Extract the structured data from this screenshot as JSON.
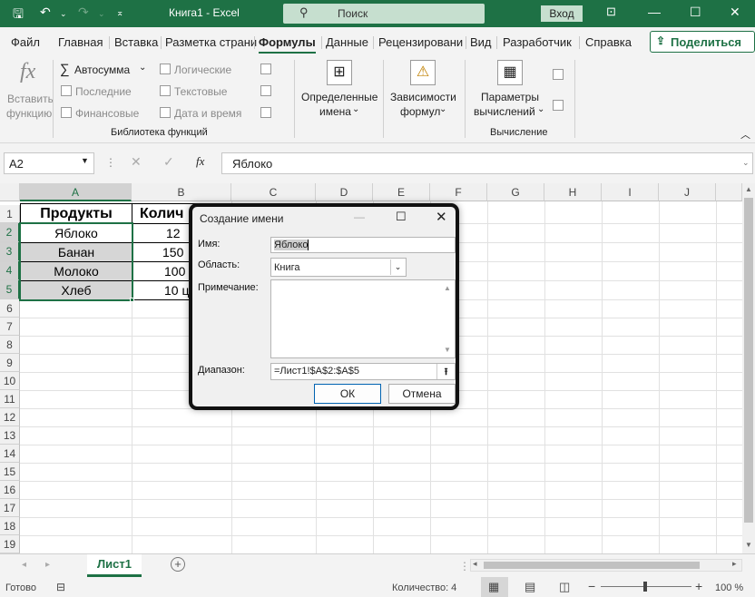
{
  "titlebar": {
    "doc_title": "Книга1  -  Excel",
    "search_placeholder": "Поиск",
    "sign_in": "Вход",
    "colors": {
      "accent": "#1e7145"
    }
  },
  "menu": {
    "tabs": [
      "Файл",
      "Главная",
      "Вставка",
      "Разметка страни",
      "Формулы",
      "Данные",
      "Рецензировани",
      "Вид",
      "Разработчик",
      "Справка"
    ],
    "active_tab": "Формулы",
    "share": "Поделиться"
  },
  "ribbon": {
    "insert_function": [
      "Вставить",
      "функцию"
    ],
    "autosum": "Автосумма",
    "recent": "Последние",
    "financial": "Финансовые",
    "logical": "Логические",
    "text": "Текстовые",
    "datetime": "Дата и время",
    "group_library": "Библиотека функций",
    "defined_names": [
      "Определенные",
      "имена"
    ],
    "dependencies": [
      "Зависимости",
      "формул"
    ],
    "calc_params": [
      "Параметры",
      "вычислений"
    ],
    "group_calc": "Вычисление"
  },
  "formula_bar": {
    "name_box": "A2",
    "fx": "fx",
    "formula": "Яблоко"
  },
  "grid": {
    "columns": [
      "A",
      "B",
      "C",
      "D",
      "E",
      "F",
      "G",
      "H",
      "I",
      "J"
    ],
    "rows": [
      "1",
      "2",
      "3",
      "4",
      "5",
      "6",
      "7",
      "8",
      "9",
      "10",
      "11",
      "12",
      "13",
      "14",
      "15",
      "16",
      "17",
      "18",
      "19"
    ],
    "cells": {
      "A1": "Продукты",
      "B1": "Колич",
      "A2": "Яблоко",
      "B2": "12 ",
      "A3": "Банан",
      "B3": "150",
      "A4": "Молоко",
      "B4": "100",
      "A5": "Хлеб",
      "B5": "10 ц"
    }
  },
  "sheets": {
    "active": "Лист1"
  },
  "status": {
    "ready": "Готово",
    "count": "Количество: 4",
    "zoom": "100 %"
  },
  "dialog": {
    "title": "Создание имени",
    "name_label": "Имя:",
    "name_value": "Яблоко",
    "scope_label": "Область:",
    "scope_value": "Книга",
    "comment_label": "Примечание:",
    "range_label": "Диапазон:",
    "range_value": "=Лист1!$A$2:$A$5",
    "ok": "ОК",
    "cancel": "Отмена"
  }
}
